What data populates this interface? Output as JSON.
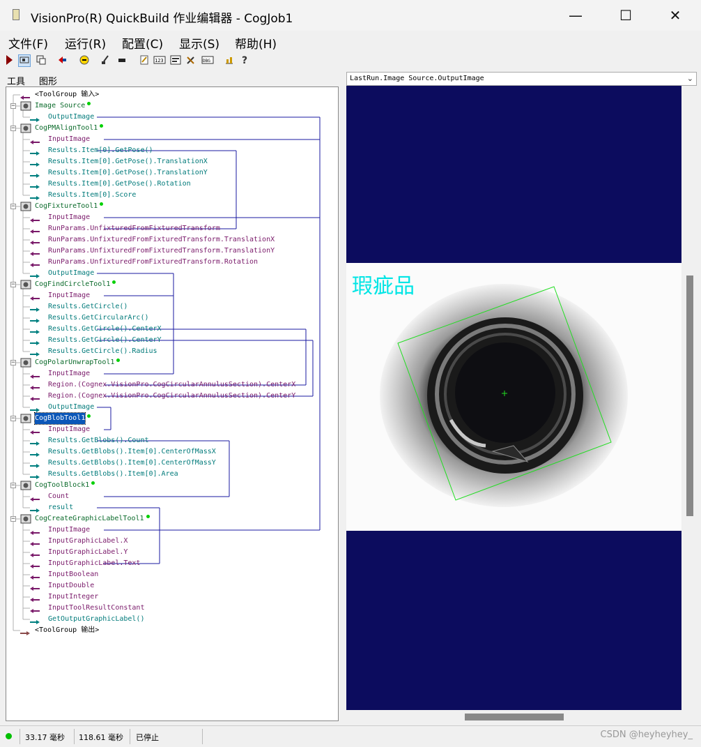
{
  "window": {
    "title": "VisionPro(R) QuickBuild 作业编辑器 - CogJob1",
    "minimize": "—",
    "maximize": "☐",
    "close": "✕"
  },
  "menu": [
    "文件(F)",
    "运行(R)",
    "配置(C)",
    "显示(S)",
    "帮助(H)"
  ],
  "tabs": [
    "工具",
    "图形"
  ],
  "tree": [
    {
      "label": "<ToolGroup 输入>",
      "type": "header"
    },
    {
      "label": "Image Source",
      "type": "tool",
      "icon": "camera-icon"
    },
    {
      "label": "OutputImage",
      "type": "out"
    },
    {
      "label": "CogPMAlignTool1",
      "type": "tool",
      "icon": "pmalign-icon"
    },
    {
      "label": "InputImage",
      "type": "in"
    },
    {
      "label": "Results.Item[0].GetPose()",
      "type": "out"
    },
    {
      "label": "Results.Item[0].GetPose().TranslationX",
      "type": "out"
    },
    {
      "label": "Results.Item[0].GetPose().TranslationY",
      "type": "out"
    },
    {
      "label": "Results.Item[0].GetPose().Rotation",
      "type": "out"
    },
    {
      "label": "Results.Item[0].Score",
      "type": "out"
    },
    {
      "label": "CogFixtureTool1",
      "type": "tool",
      "icon": "fixture-icon"
    },
    {
      "label": "InputImage",
      "type": "in"
    },
    {
      "label": "RunParams.UnfixturedFromFixturedTransform",
      "type": "in"
    },
    {
      "label": "RunParams.UnfixturedFromFixturedTransform.TranslationX",
      "type": "in"
    },
    {
      "label": "RunParams.UnfixturedFromFixturedTransform.TranslationY",
      "type": "in"
    },
    {
      "label": "RunParams.UnfixturedFromFixturedTransform.Rotation",
      "type": "in"
    },
    {
      "label": "OutputImage",
      "type": "out"
    },
    {
      "label": "CogFindCircleTool1",
      "type": "tool",
      "icon": "findcircle-icon"
    },
    {
      "label": "InputImage",
      "type": "in"
    },
    {
      "label": "Results.GetCircle()",
      "type": "out"
    },
    {
      "label": "Results.GetCircularArc()",
      "type": "out"
    },
    {
      "label": "Results.GetCircle().CenterX",
      "type": "out"
    },
    {
      "label": "Results.GetCircle().CenterY",
      "type": "out"
    },
    {
      "label": "Results.GetCircle().Radius",
      "type": "out"
    },
    {
      "label": "CogPolarUnwrapTool1",
      "type": "tool",
      "icon": "polarunwrap-icon"
    },
    {
      "label": "InputImage",
      "type": "in"
    },
    {
      "label": "Region.(Cognex.VisionPro.CogCircularAnnulusSection).CenterX",
      "type": "in"
    },
    {
      "label": "Region.(Cognex.VisionPro.CogCircularAnnulusSection).CenterY",
      "type": "in"
    },
    {
      "label": "OutputImage",
      "type": "out"
    },
    {
      "label": "CogBlobTool1",
      "type": "tool",
      "icon": "blob-icon",
      "selected": true
    },
    {
      "label": "InputImage",
      "type": "in"
    },
    {
      "label": "Results.GetBlobs().Count",
      "type": "out"
    },
    {
      "label": "Results.GetBlobs().Item[0].CenterOfMassX",
      "type": "out"
    },
    {
      "label": "Results.GetBlobs().Item[0].CenterOfMassY",
      "type": "out"
    },
    {
      "label": "Results.GetBlobs().Item[0].Area",
      "type": "out"
    },
    {
      "label": "CogToolBlock1",
      "type": "tool",
      "icon": "toolblock-icon"
    },
    {
      "label": "Count",
      "type": "in"
    },
    {
      "label": "result",
      "type": "out"
    },
    {
      "label": "CogCreateGraphicLabelTool1",
      "type": "tool",
      "icon": "graphiclabel-icon"
    },
    {
      "label": "InputImage",
      "type": "in"
    },
    {
      "label": "InputGraphicLabel.X",
      "type": "in"
    },
    {
      "label": "InputGraphicLabel.Y",
      "type": "in"
    },
    {
      "label": "InputGraphicLabel.Text",
      "type": "in"
    },
    {
      "label": "InputBoolean",
      "type": "in"
    },
    {
      "label": "InputDouble",
      "type": "in"
    },
    {
      "label": "InputInteger",
      "type": "in"
    },
    {
      "label": "InputToolResultConstant",
      "type": "in"
    },
    {
      "label": "GetOutputGraphicLabel()",
      "type": "out"
    },
    {
      "label": "<ToolGroup 输出>",
      "type": "footer"
    }
  ],
  "display": {
    "selector": "LastRun.Image Source.OutputImage",
    "overlay_text": "瑕疵品"
  },
  "status": {
    "time1": "33.17 毫秒",
    "time2": "118.61 毫秒",
    "state": "已停止",
    "watermark": "CSDN @heyheyhey_"
  },
  "colors": {
    "input_arrow": "#7a1a6a",
    "output_arrow": "#008080",
    "link_line": "#1a1aa0",
    "display_bg": "#0c0c5e",
    "overlay_text": "#00e5e5",
    "roi_box": "#22dd22",
    "status_ok": "#00c000"
  }
}
